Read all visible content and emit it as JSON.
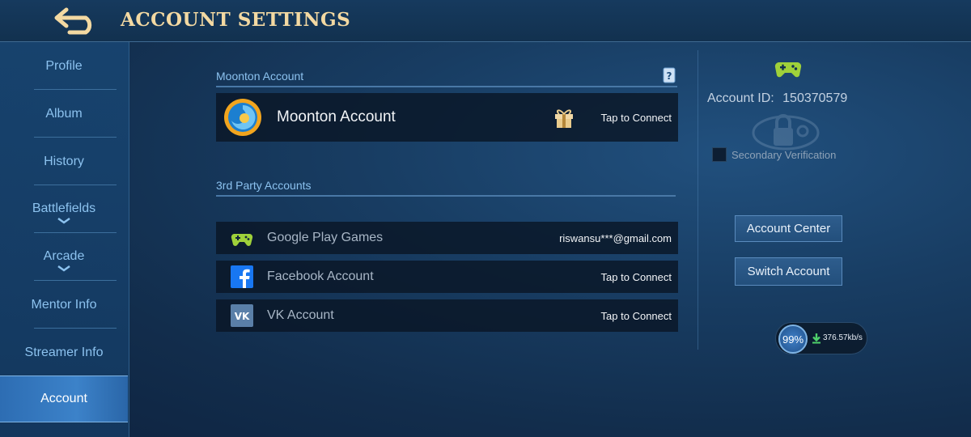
{
  "header": {
    "title": "ACCOUNT SETTINGS"
  },
  "sidebar": {
    "items": [
      {
        "label": "Profile"
      },
      {
        "label": "Album"
      },
      {
        "label": "History"
      },
      {
        "label": "Battlefields"
      },
      {
        "label": "Arcade"
      },
      {
        "label": "Mentor Info"
      },
      {
        "label": "Streamer Info"
      },
      {
        "label": "Account"
      }
    ],
    "active": "Account"
  },
  "moonton": {
    "section_title": "Moonton Account",
    "account_label": "Moonton Account",
    "action": "Tap to Connect"
  },
  "third_party": {
    "section_title": "3rd Party Accounts",
    "rows": [
      {
        "label": "Google Play Games",
        "action": "riswansu***@gmail.com",
        "icon": "gamepad-icon"
      },
      {
        "label": "Facebook Account",
        "action": "Tap to Connect",
        "icon": "facebook-icon"
      },
      {
        "label": "VK Account",
        "action": "Tap to Connect",
        "icon": "vk-icon"
      }
    ]
  },
  "account_panel": {
    "account_id_label": "Account ID:",
    "account_id": "150370579",
    "secondary_verification": "Secondary Verification",
    "secondary_verification_checked": false,
    "account_center_label": "Account Center",
    "switch_account_label": "Switch Account"
  },
  "network": {
    "percent": "99%",
    "rate": "376.57kb/s"
  },
  "colors": {
    "title_gold": "#f3d9a2",
    "accent_blue": "#8cc2ef",
    "gamepad_green": "#9fd13a",
    "facebook_blue": "#1877f2",
    "vk_blue": "#5a7fa8"
  }
}
